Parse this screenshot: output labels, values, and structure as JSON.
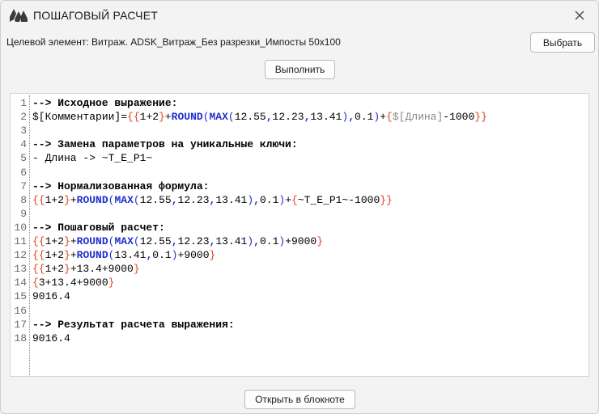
{
  "window": {
    "title": "ПОШАГОВЫЙ РАСЧЕТ",
    "logo_icon": "mountain-logo-icon",
    "close_icon": "close-icon"
  },
  "target": {
    "label": "Целевой элемент: Витраж. ADSK_Витраж_Без разрезки_Импосты 50х100"
  },
  "buttons": {
    "select": "Выбрать",
    "run": "Выполнить",
    "open_notepad": "Открыть в блокноте"
  },
  "colors": {
    "braces": "#e0401a",
    "functions": "#1f2fd0",
    "reference": "#888888"
  },
  "editor": {
    "lines": [
      {
        "n": "1",
        "segs": [
          {
            "c": "cm",
            "t": "--> Исходное выражение:"
          }
        ]
      },
      {
        "n": "2",
        "segs": [
          {
            "c": "",
            "t": "$[Комментарии]="
          },
          {
            "c": "br",
            "t": "{{"
          },
          {
            "c": "",
            "t": "1+2"
          },
          {
            "c": "br",
            "t": "}"
          },
          {
            "c": "",
            "t": "+"
          },
          {
            "c": "fn",
            "t": "ROUND"
          },
          {
            "c": "pr",
            "t": "("
          },
          {
            "c": "fn",
            "t": "MAX"
          },
          {
            "c": "pr",
            "t": "("
          },
          {
            "c": "",
            "t": "12.55"
          },
          {
            "c": "sep",
            "t": ","
          },
          {
            "c": "",
            "t": "12.23"
          },
          {
            "c": "sep",
            "t": ","
          },
          {
            "c": "",
            "t": "13.41"
          },
          {
            "c": "pr",
            "t": ")"
          },
          {
            "c": "sep",
            "t": ","
          },
          {
            "c": "",
            "t": "0.1"
          },
          {
            "c": "pr",
            "t": ")"
          },
          {
            "c": "",
            "t": "+"
          },
          {
            "c": "br",
            "t": "{"
          },
          {
            "c": "ref",
            "t": "$[Длина]"
          },
          {
            "c": "",
            "t": "-1000"
          },
          {
            "c": "br",
            "t": "}}"
          }
        ]
      },
      {
        "n": "3",
        "segs": []
      },
      {
        "n": "4",
        "segs": [
          {
            "c": "cm",
            "t": "--> Замена параметров на уникальные ключи:"
          }
        ]
      },
      {
        "n": "5",
        "segs": [
          {
            "c": "",
            "t": "- Длина -> ~T_E_P1~"
          }
        ]
      },
      {
        "n": "6",
        "segs": []
      },
      {
        "n": "7",
        "segs": [
          {
            "c": "cm",
            "t": "--> Нормализованная формула:"
          }
        ]
      },
      {
        "n": "8",
        "segs": [
          {
            "c": "br",
            "t": "{{"
          },
          {
            "c": "",
            "t": "1+2"
          },
          {
            "c": "br",
            "t": "}"
          },
          {
            "c": "",
            "t": "+"
          },
          {
            "c": "fn",
            "t": "ROUND"
          },
          {
            "c": "pr",
            "t": "("
          },
          {
            "c": "fn",
            "t": "MAX"
          },
          {
            "c": "pr",
            "t": "("
          },
          {
            "c": "",
            "t": "12.55"
          },
          {
            "c": "sep",
            "t": ","
          },
          {
            "c": "",
            "t": "12.23"
          },
          {
            "c": "sep",
            "t": ","
          },
          {
            "c": "",
            "t": "13.41"
          },
          {
            "c": "pr",
            "t": ")"
          },
          {
            "c": "sep",
            "t": ","
          },
          {
            "c": "",
            "t": "0.1"
          },
          {
            "c": "pr",
            "t": ")"
          },
          {
            "c": "",
            "t": "+"
          },
          {
            "c": "br",
            "t": "{"
          },
          {
            "c": "",
            "t": "~T_E_P1~-1000"
          },
          {
            "c": "br",
            "t": "}}"
          }
        ]
      },
      {
        "n": "9",
        "segs": []
      },
      {
        "n": "10",
        "segs": [
          {
            "c": "cm",
            "t": "--> Пошаговый расчет:"
          }
        ]
      },
      {
        "n": "11",
        "segs": [
          {
            "c": "br",
            "t": "{{"
          },
          {
            "c": "",
            "t": "1+2"
          },
          {
            "c": "br",
            "t": "}"
          },
          {
            "c": "",
            "t": "+"
          },
          {
            "c": "fn",
            "t": "ROUND"
          },
          {
            "c": "pr",
            "t": "("
          },
          {
            "c": "fn",
            "t": "MAX"
          },
          {
            "c": "pr",
            "t": "("
          },
          {
            "c": "",
            "t": "12.55"
          },
          {
            "c": "sep",
            "t": ","
          },
          {
            "c": "",
            "t": "12.23"
          },
          {
            "c": "sep",
            "t": ","
          },
          {
            "c": "",
            "t": "13.41"
          },
          {
            "c": "pr",
            "t": ")"
          },
          {
            "c": "sep",
            "t": ","
          },
          {
            "c": "",
            "t": "0.1"
          },
          {
            "c": "pr",
            "t": ")"
          },
          {
            "c": "",
            "t": "+9000"
          },
          {
            "c": "br",
            "t": "}"
          }
        ]
      },
      {
        "n": "12",
        "segs": [
          {
            "c": "br",
            "t": "{{"
          },
          {
            "c": "",
            "t": "1+2"
          },
          {
            "c": "br",
            "t": "}"
          },
          {
            "c": "",
            "t": "+"
          },
          {
            "c": "fn",
            "t": "ROUND"
          },
          {
            "c": "pr",
            "t": "("
          },
          {
            "c": "",
            "t": "13.41"
          },
          {
            "c": "sep",
            "t": ","
          },
          {
            "c": "",
            "t": "0.1"
          },
          {
            "c": "pr",
            "t": ")"
          },
          {
            "c": "",
            "t": "+9000"
          },
          {
            "c": "br",
            "t": "}"
          }
        ]
      },
      {
        "n": "13",
        "segs": [
          {
            "c": "br",
            "t": "{{"
          },
          {
            "c": "",
            "t": "1+2"
          },
          {
            "c": "br",
            "t": "}"
          },
          {
            "c": "",
            "t": "+13.4+9000"
          },
          {
            "c": "br",
            "t": "}"
          }
        ]
      },
      {
        "n": "14",
        "segs": [
          {
            "c": "br",
            "t": "{"
          },
          {
            "c": "",
            "t": "3+13.4+9000"
          },
          {
            "c": "br",
            "t": "}"
          }
        ]
      },
      {
        "n": "15",
        "segs": [
          {
            "c": "",
            "t": "9016.4"
          }
        ]
      },
      {
        "n": "16",
        "segs": []
      },
      {
        "n": "17",
        "segs": [
          {
            "c": "cm",
            "t": "--> Результат расчета выражения:"
          }
        ]
      },
      {
        "n": "18",
        "segs": [
          {
            "c": "",
            "t": "9016.4"
          }
        ]
      }
    ]
  }
}
